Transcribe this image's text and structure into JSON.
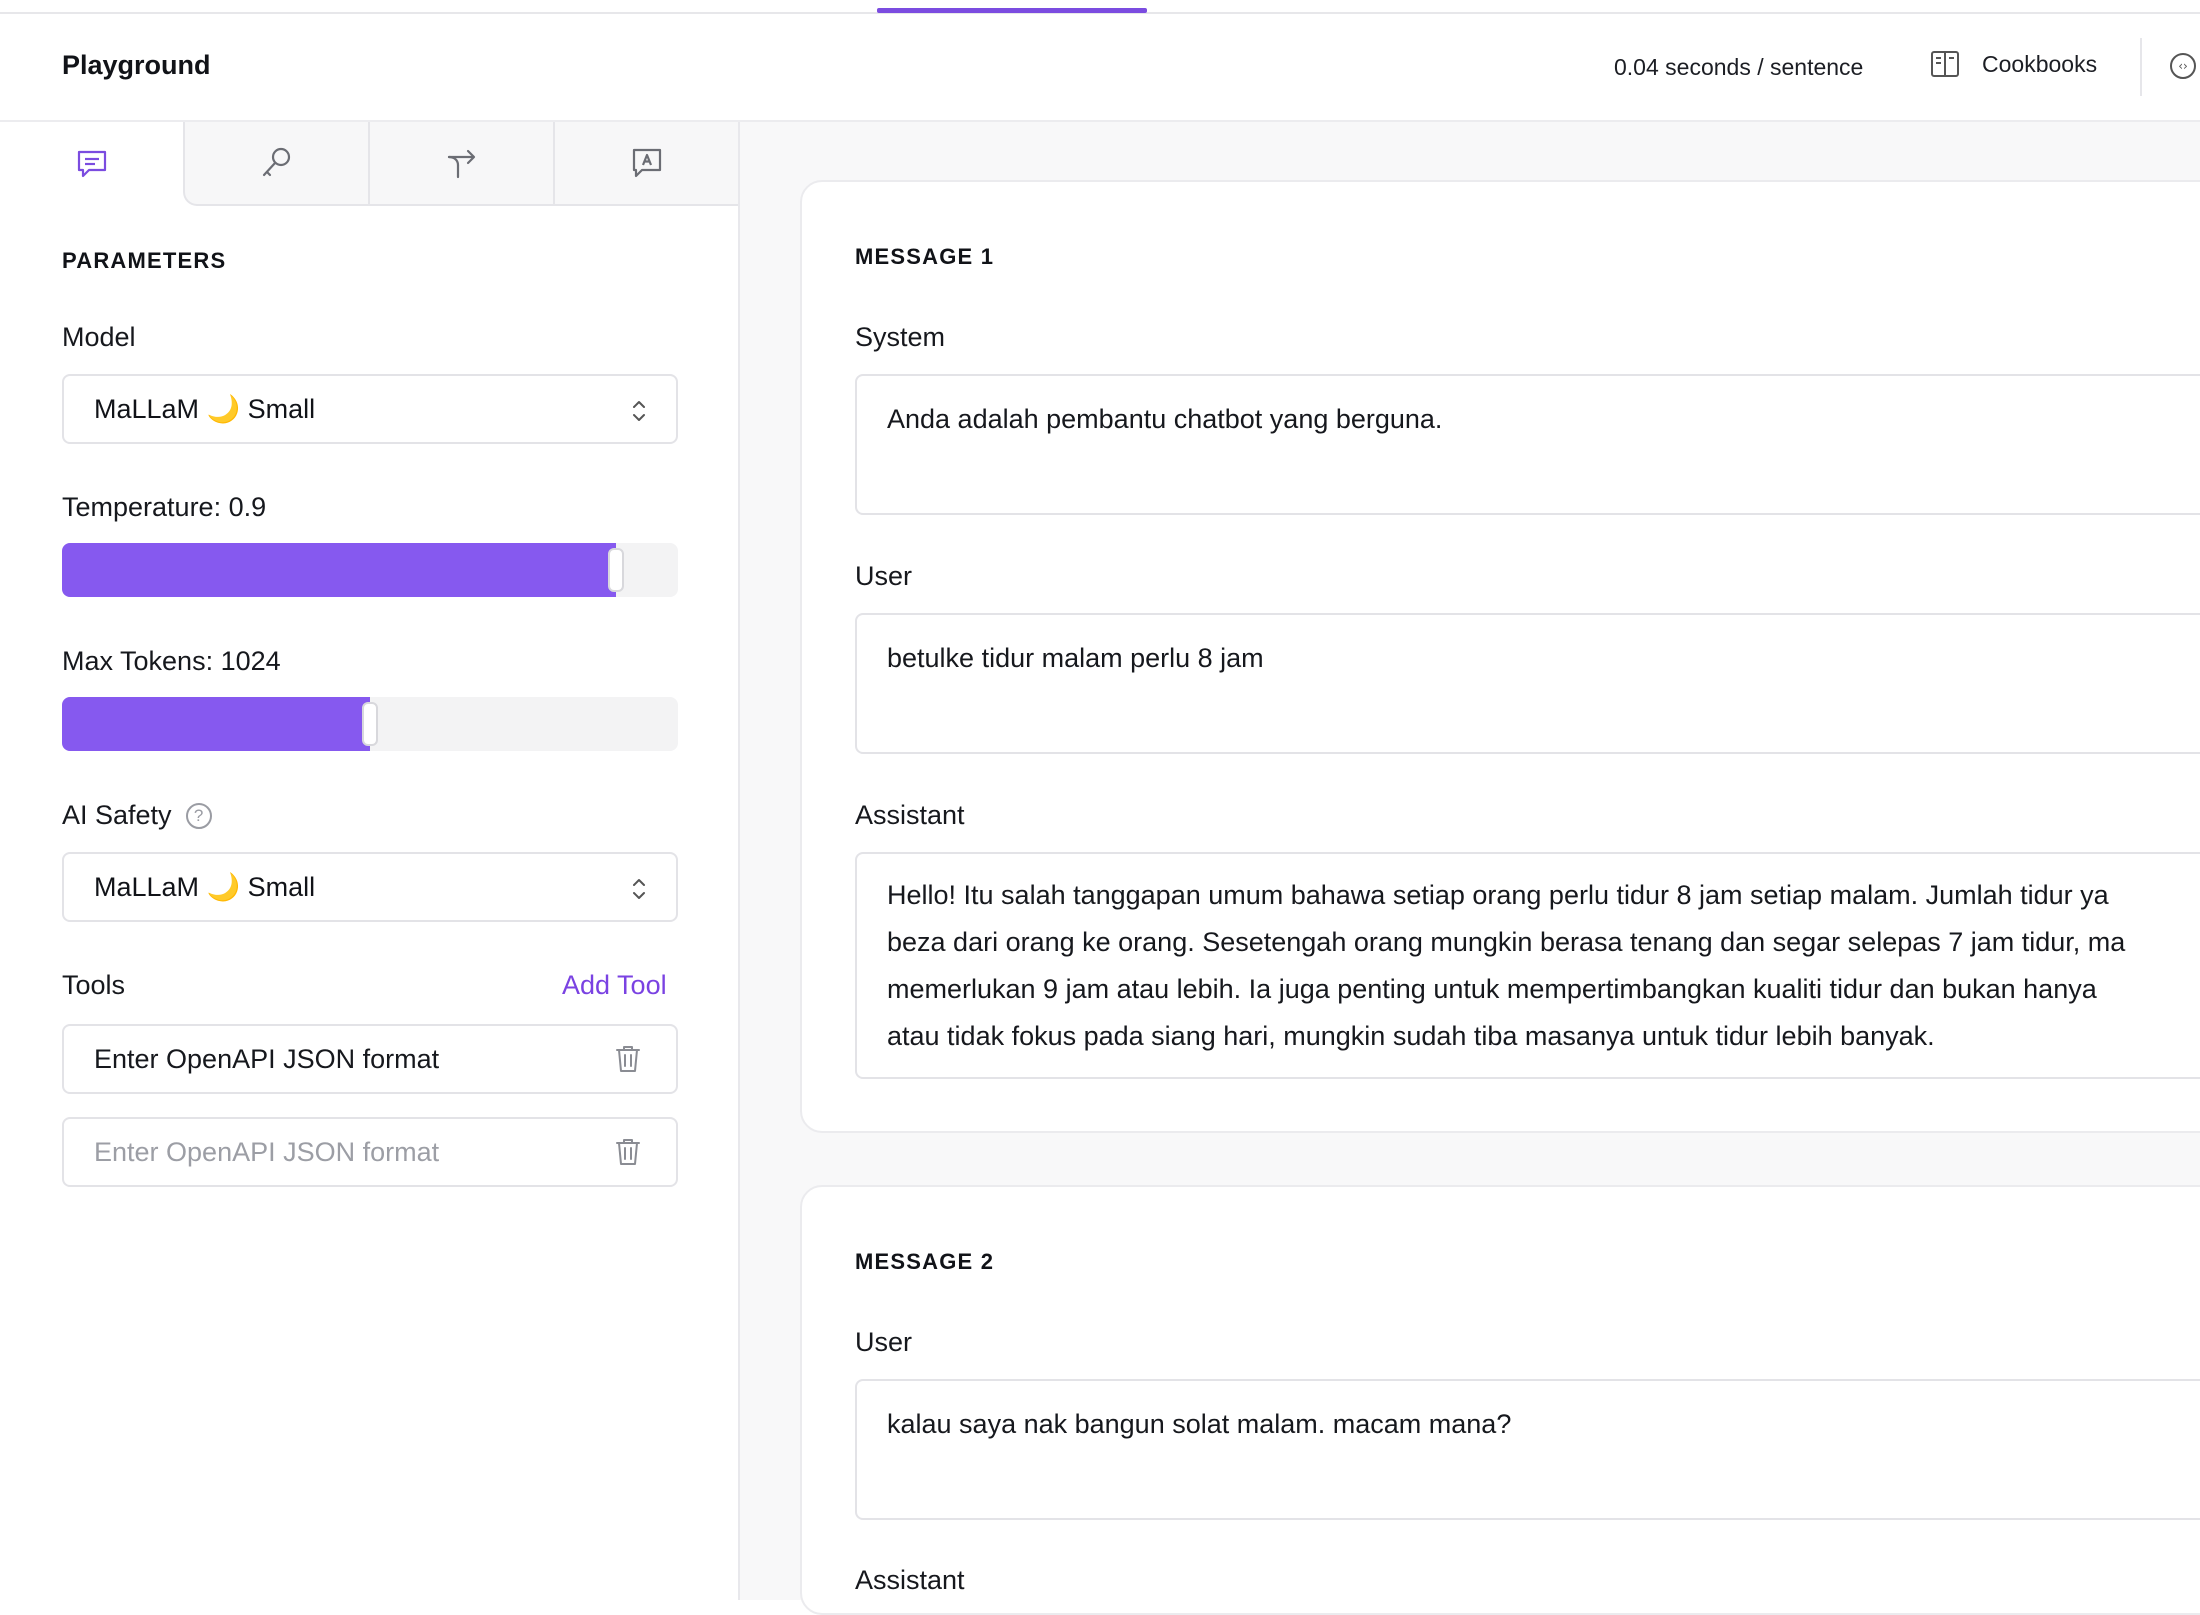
{
  "header": {
    "title": "Playground",
    "speed": "0.04 seconds / sentence",
    "cookbooks_label": "Cookbooks",
    "code_glyph": "‹›"
  },
  "sidebar": {
    "tabs": [
      {
        "name": "chat",
        "icon": "chat-icon",
        "active": true
      },
      {
        "name": "key",
        "icon": "key-icon",
        "active": false
      },
      {
        "name": "route",
        "icon": "route-arrow-icon",
        "active": false
      },
      {
        "name": "assistant",
        "icon": "assistant-message-icon",
        "active": false
      }
    ],
    "section_title": "PARAMETERS",
    "model": {
      "label": "Model",
      "value": "MaLLaM 🌙 Small"
    },
    "temperature": {
      "label": "Temperature: 0.9",
      "fraction": 0.9
    },
    "max_tokens": {
      "label": "Max Tokens: 1024",
      "fraction": 0.5
    },
    "ai_safety": {
      "label": "AI Safety",
      "help": "?",
      "value": "MaLLaM 🌙 Small"
    },
    "tools": {
      "label": "Tools",
      "add_label": "Add Tool",
      "inputs": [
        {
          "value": "Enter OpenAPI JSON format",
          "placeholder": ""
        },
        {
          "value": "",
          "placeholder": "Enter OpenAPI JSON format"
        }
      ]
    }
  },
  "messages": [
    {
      "title": "MESSAGE 1",
      "system_label": "System",
      "system_text": "Anda adalah pembantu chatbot yang berguna.",
      "user_label": "User",
      "user_text": "betulke tidur malam perlu 8 jam",
      "assistant_label": "Assistant",
      "assistant_lines": [
        "Hello! Itu salah tanggapan umum bahawa setiap orang perlu tidur 8 jam setiap malam. Jumlah tidur ya",
        "beza dari orang ke orang. Sesetengah orang mungkin berasa tenang dan segar selepas 7 jam tidur, ma",
        "memerlukan 9 jam atau lebih. Ia juga penting untuk mempertimbangkan kualiti tidur dan bukan hanya",
        "atau tidak fokus pada siang hari, mungkin sudah tiba masanya untuk tidur lebih banyak."
      ]
    },
    {
      "title": "MESSAGE 2",
      "user_label": "User",
      "user_text": "kalau saya nak bangun solat malam. macam mana?",
      "assistant_label": "Assistant"
    }
  ],
  "colors": {
    "accent": "#8659ef",
    "link": "#7a42e2",
    "border": "#e3e3e7"
  }
}
